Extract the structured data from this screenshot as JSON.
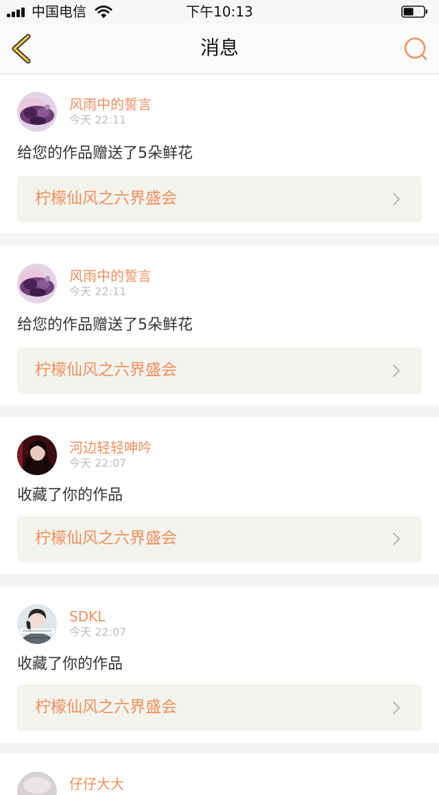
{
  "status_bar": {
    "carrier": "中国电信",
    "time": "下午10:13"
  },
  "nav": {
    "title": "消息",
    "back_icon": "chevron-left-icon",
    "search_icon": "search-icon"
  },
  "messages": [
    {
      "user": "风雨中的誓言",
      "time": "今天 22:11",
      "text": "给您的作品赠送了5朵鲜花",
      "work": "柠檬仙风之六界盛会",
      "avatar_icon": "avatar-purple-flowers"
    },
    {
      "user": "风雨中的誓言",
      "time": "今天 22:11",
      "text": "给您的作品赠送了5朵鲜花",
      "work": "柠檬仙风之六界盛会",
      "avatar_icon": "avatar-purple-flowers"
    },
    {
      "user": "河边轻轻呻吟",
      "time": "今天 22:07",
      "text": "收藏了你的作品",
      "work": "柠檬仙风之六界盛会",
      "avatar_icon": "avatar-dark-portrait"
    },
    {
      "user": "SDKL",
      "time": "今天 22:07",
      "text": "收藏了你的作品",
      "work": "柠檬仙风之六界盛会",
      "avatar_icon": "avatar-girl-portrait"
    },
    {
      "user": "仔仔大大",
      "avatar_icon": "avatar-gray"
    }
  ],
  "colors": {
    "accent": "#ee8f5c",
    "back_icon": "#e8b83a",
    "card_bg": "#ffffff",
    "work_bg": "#f4f4ee",
    "page_bg": "#f4f4f4"
  }
}
